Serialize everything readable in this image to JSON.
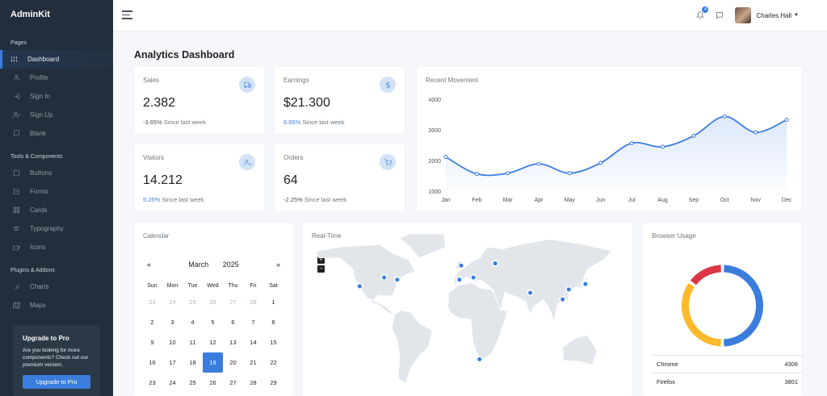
{
  "brand": "AdminKit",
  "sidebar": {
    "sections": [
      {
        "header": "Pages",
        "items": [
          {
            "label": "Dashboard",
            "icon": "sliders-icon",
            "active": true
          },
          {
            "label": "Profile",
            "icon": "user-icon"
          },
          {
            "label": "Sign In",
            "icon": "log-in-icon"
          },
          {
            "label": "Sign Up",
            "icon": "user-plus-icon"
          },
          {
            "label": "Blank",
            "icon": "book-icon"
          }
        ]
      },
      {
        "header": "Tools & Components",
        "items": [
          {
            "label": "Buttons",
            "icon": "square-icon"
          },
          {
            "label": "Forms",
            "icon": "check-square-icon"
          },
          {
            "label": "Cards",
            "icon": "grid-icon"
          },
          {
            "label": "Typography",
            "icon": "align-left-icon"
          },
          {
            "label": "Icons",
            "icon": "coffee-icon"
          }
        ]
      },
      {
        "header": "Plugins & Addons",
        "items": [
          {
            "label": "Charts",
            "icon": "bar-chart-icon"
          },
          {
            "label": "Maps",
            "icon": "map-icon"
          }
        ]
      }
    ],
    "upgrade": {
      "title": "Upgrade to Pro",
      "description": "Are you looking for more components? Check out our premium version.",
      "button": "Upgrade to Pro"
    }
  },
  "topnav": {
    "notifications_count": "4",
    "user_name": "Charles Hall"
  },
  "page": {
    "title_bold": "Analytics",
    "title_rest": " Dashboard"
  },
  "stats": [
    {
      "title": "Sales",
      "value": "2.382",
      "pct": "-3.65%",
      "pct_positive": false,
      "since": " Since last week",
      "icon": "truck-icon"
    },
    {
      "title": "Earnings",
      "value": "$21.300",
      "pct": "6.65%",
      "pct_positive": true,
      "since": " Since last week",
      "icon": "dollar-icon"
    },
    {
      "title": "Visitors",
      "value": "14.212",
      "pct": "5.25%",
      "pct_positive": true,
      "since": " Since last week",
      "icon": "users-icon"
    },
    {
      "title": "Orders",
      "value": "64",
      "pct": "-2.25%",
      "pct_positive": false,
      "since": " Since last week",
      "icon": "shopping-cart-icon"
    }
  ],
  "recent_movement": {
    "title": "Recent Movement"
  },
  "chart_data": {
    "type": "area",
    "title": "Recent Movement",
    "categories": [
      "Jan",
      "Feb",
      "Mar",
      "Apr",
      "May",
      "Jun",
      "Jul",
      "Aug",
      "Sep",
      "Oct",
      "Nov",
      "Dec"
    ],
    "values": [
      2115,
      1562,
      1584,
      1892,
      1587,
      1923,
      2566,
      2448,
      2805,
      3438,
      2917,
      3327
    ],
    "ylim": [
      1000,
      4000
    ],
    "yticks": [
      "4000",
      "3000",
      "2000",
      "1000"
    ],
    "xlabel": "",
    "ylabel": "",
    "grid": false,
    "color": "#3b7ddd"
  },
  "calendar": {
    "title": "Calendar",
    "month": "March",
    "year": "2025",
    "prev": "«",
    "next": "»",
    "dow": [
      "Sun",
      "Mon",
      "Tue",
      "Wed",
      "Thu",
      "Fri",
      "Sat"
    ],
    "prev_days": [
      "23",
      "24",
      "25",
      "26",
      "27",
      "28"
    ],
    "days": [
      "1",
      "2",
      "3",
      "4",
      "5",
      "6",
      "7",
      "8",
      "9",
      "10",
      "11",
      "12",
      "13",
      "14",
      "15",
      "16",
      "17",
      "18",
      "19",
      "20",
      "21",
      "22",
      "23",
      "24",
      "25",
      "26",
      "27",
      "28",
      "29"
    ],
    "selected": "19"
  },
  "realtime": {
    "title": "Real-Time",
    "zoom_in": "+",
    "zoom_out": "−",
    "markers": [
      [
        -75,
        40
      ],
      [
        -90,
        42
      ],
      [
        -118,
        34
      ],
      [
        -2,
        53
      ],
      [
        -4,
        40
      ],
      [
        12,
        42
      ],
      [
        37,
        55
      ],
      [
        77,
        28
      ],
      [
        114,
        22
      ],
      [
        121,
        31
      ],
      [
        140,
        36
      ],
      [
        19,
        -33
      ]
    ]
  },
  "browser_usage": {
    "title": "Browser Usage",
    "donut_colors": [
      "#3b7ddd",
      "#fcb92c",
      "#dc3545"
    ],
    "donut_fractions": [
      0.5,
      0.35,
      0.15
    ],
    "rows": [
      {
        "name": "Chrome",
        "value": "4306"
      },
      {
        "name": "Firefox",
        "value": "3801"
      }
    ]
  }
}
